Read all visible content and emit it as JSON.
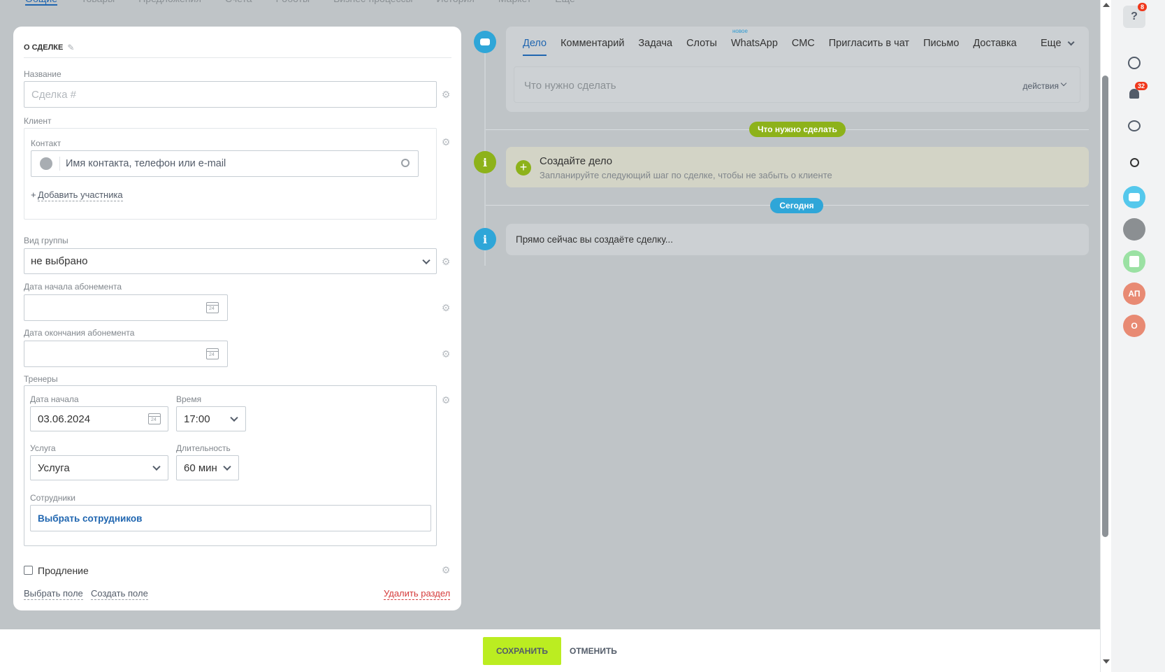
{
  "top_tabs": [
    "Общие",
    "Товары",
    "Предложения",
    "Счета",
    "Роботы",
    "Бизнес-процессы",
    "История",
    "Маркет",
    "Еще"
  ],
  "card": {
    "title": "О СДЕЛКЕ",
    "name_label": "Название",
    "name_placeholder": "Сделка #",
    "client_label": "Клиент",
    "contact_label": "Контакт",
    "contact_placeholder": "Имя контакта, телефон или e-mail",
    "add_participant": "Добавить участника",
    "group_label": "Вид группы",
    "group_value": "не выбрано",
    "sub_start_label": "Дата начала абонемента",
    "sub_end_label": "Дата окончания абонемента",
    "trainers_label": "Тренеры",
    "start_date_label": "Дата начала",
    "start_date_value": "03.06.2024",
    "time_label": "Время",
    "time_value": "17:00",
    "service_label": "Услуга",
    "service_value": "Услуга",
    "duration_label": "Длительность",
    "duration_value": "60 мин",
    "staff_label": "Сотрудники",
    "staff_link": "Выбрать сотрудников",
    "renewal_label": "Продление",
    "select_field": "Выбрать поле",
    "create_field": "Создать поле",
    "delete_section": "Удалить раздел"
  },
  "timeline": {
    "tabs": [
      "Дело",
      "Комментарий",
      "Задача",
      "Слоты",
      "WhatsApp",
      "СМС",
      "Пригласить в чат",
      "Письмо",
      "Доставка"
    ],
    "new_badge": "новое",
    "more": "Еще",
    "todo_placeholder": "Что нужно сделать",
    "actions": "действия",
    "pill_todo": "Что нужно сделать",
    "create_title": "Создайте дело",
    "create_sub": "Запланируйте следующий шаг по сделке, чтобы не забыть о клиенте",
    "pill_today": "Сегодня",
    "now_text": "Прямо сейчас вы создаёте сделку..."
  },
  "bottom": {
    "save": "СОХРАНИТЬ",
    "cancel": "ОТМЕНИТЬ"
  },
  "sidebar": {
    "help_count": "8",
    "notif_count": "32",
    "avatar_ap": "АП",
    "avatar_o": "О"
  },
  "colors": {
    "accent_blue": "#2066b0",
    "save_green": "#bbed21",
    "todo_pill": "#8db21a",
    "today_pill": "#2fa6d8",
    "badge_red": "#f0371b"
  }
}
